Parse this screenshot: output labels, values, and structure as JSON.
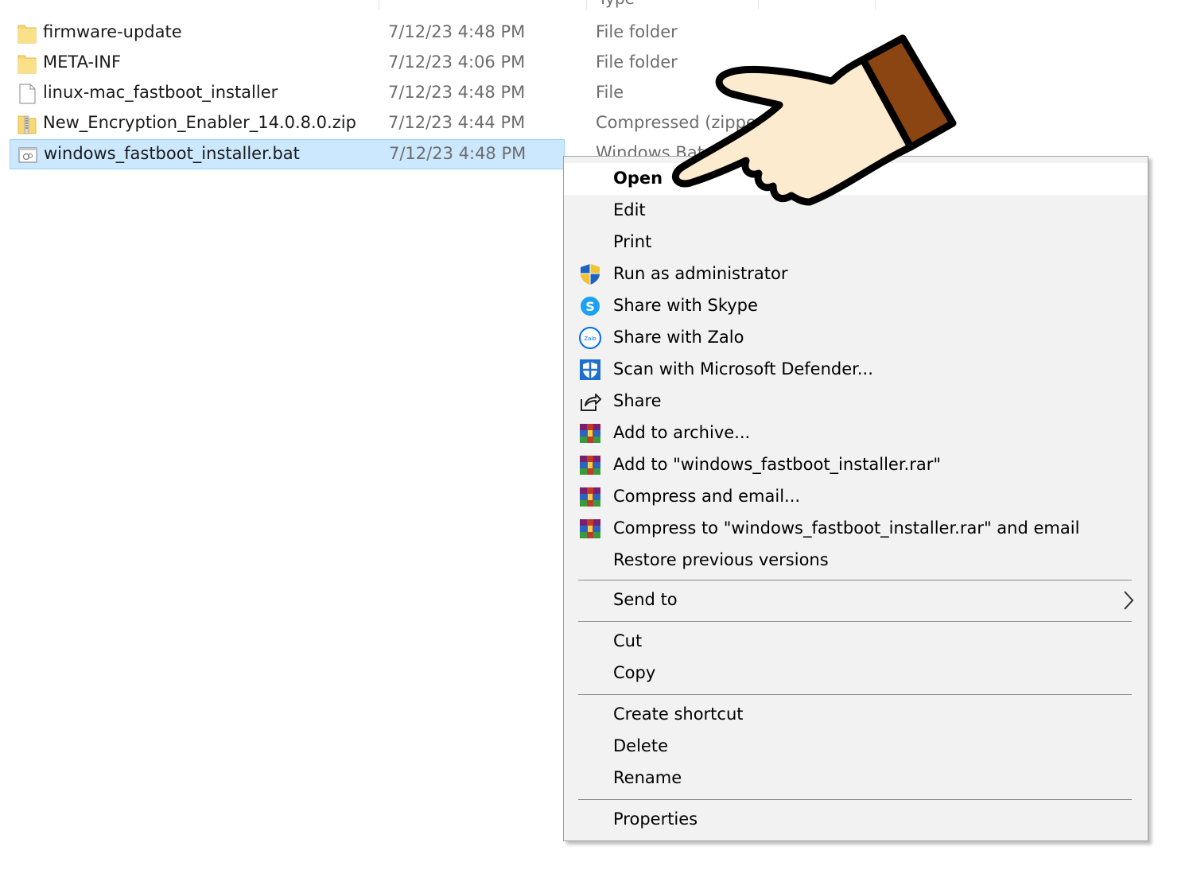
{
  "file_list": {
    "header_remnant": "Type",
    "rows": [
      {
        "name": "firmware-update",
        "date": "7/12/23 4:48 PM",
        "type": "File folder",
        "icon": "folder-icon"
      },
      {
        "name": "META-INF",
        "date": "7/12/23 4:06 PM",
        "type": "File folder",
        "icon": "folder-icon"
      },
      {
        "name": "linux-mac_fastboot_installer",
        "date": "7/12/23 4:48 PM",
        "type": "File",
        "icon": "file-icon"
      },
      {
        "name": "New_Encryption_Enabler_14.0.8.0.zip",
        "date": "7/12/23 4:44 PM",
        "type": "Compressed (zipped) Folder",
        "icon": "zip-icon"
      },
      {
        "name": "windows_fastboot_installer.bat",
        "date": "7/12/23 4:48 PM",
        "type": "Windows Batch File",
        "icon": "batch-file-icon",
        "selected": true
      }
    ]
  },
  "context_menu": {
    "open": "Open",
    "edit": "Edit",
    "print": "Print",
    "run_as_admin": "Run as administrator",
    "share_skype": "Share with Skype",
    "share_zalo": "Share with Zalo",
    "scan_defender": "Scan with Microsoft Defender...",
    "share": "Share",
    "add_archive": "Add to archive...",
    "add_to_rar": "Add to \"windows_fastboot_installer.rar\"",
    "compress_email": "Compress and email...",
    "compress_rar_email": "Compress to \"windows_fastboot_installer.rar\" and email",
    "restore_versions": "Restore previous versions",
    "send_to": "Send to",
    "cut": "Cut",
    "copy": "Copy",
    "create_shortcut": "Create shortcut",
    "delete": "Delete",
    "rename": "Rename",
    "properties": "Properties",
    "zalo_icon_text": "Zalo"
  },
  "colors": {
    "selection_bg": "#cce8ff",
    "selection_border": "#99d1ff",
    "menu_bg": "#f2f2f2",
    "folder_yellow": "#f8d775",
    "hand_skin": "#fdebd0",
    "hand_cuff": "#8b4513"
  }
}
